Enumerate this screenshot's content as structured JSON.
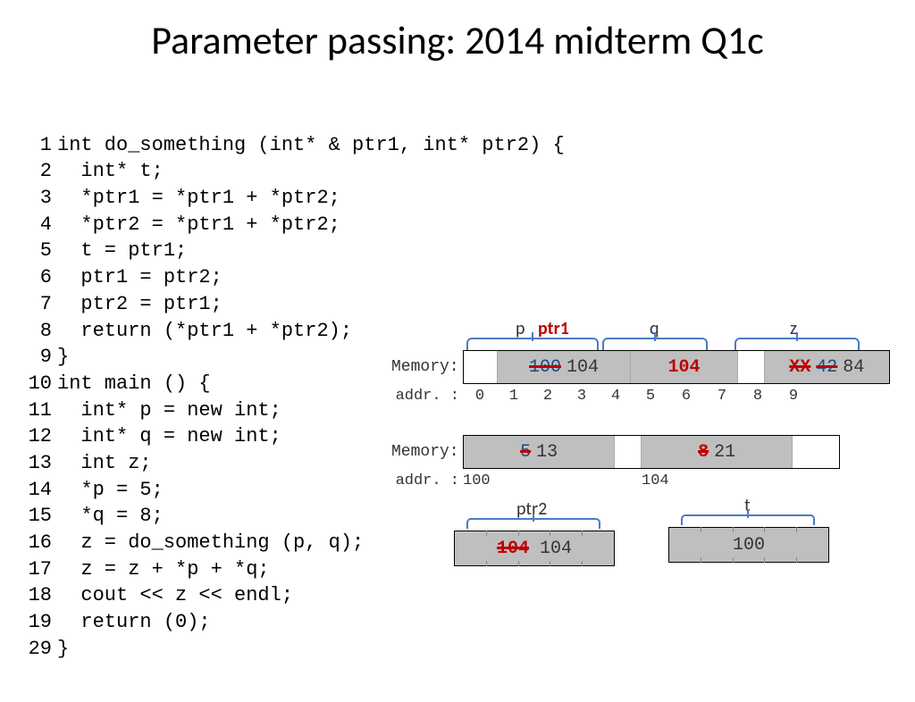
{
  "title": "Parameter passing: 2014 midterm Q1c",
  "code": {
    "l1": "int do_something (int* & ptr1, int* ptr2) {",
    "l2": "  int* t;",
    "l3": "  *ptr1 = *ptr1 + *ptr2;",
    "l4": "  *ptr2 = *ptr1 + *ptr2;",
    "l5": "  t = ptr1;",
    "l6": "  ptr1 = ptr2;",
    "l7": "  ptr2 = ptr1;",
    "l8": "  return (*ptr1 + *ptr2);",
    "l9": "}",
    "l10": "int main () {",
    "l11": "  int* p = new int;",
    "l12": "  int* q = new int;",
    "l13": "  int z;",
    "l14": "  *p = 5;",
    "l15": "  *q = 8;",
    "l16": "  z = do_something (p, q);",
    "l17": "  z = z + *p + *q;",
    "l18": "  cout << z << endl;",
    "l19": "  return (0);",
    "l29": "}"
  },
  "mem1": {
    "label_memory": "Memory:",
    "label_addr": "addr. :",
    "labels": {
      "p": "p",
      "ptr1": "ptr1",
      "q": "q",
      "z": "z"
    },
    "p_old": "100",
    "p_new": "104",
    "q_val": "104",
    "z_old": "XX",
    "z_mid": "42",
    "z_new": "84",
    "addrs": [
      "0",
      "1",
      "2",
      "3",
      "4",
      "5",
      "6",
      "7",
      "8",
      "9"
    ]
  },
  "mem2": {
    "label_memory": "Memory:",
    "label_addr": "addr. :",
    "cell1_old": "5",
    "cell1_new": "13",
    "cell2_old": "8",
    "cell2_new": "21",
    "addr1": "100",
    "addr2": "104"
  },
  "ptr2": {
    "label": "ptr2",
    "old": "104",
    "new": "104"
  },
  "t": {
    "label": "t",
    "val": "100"
  }
}
